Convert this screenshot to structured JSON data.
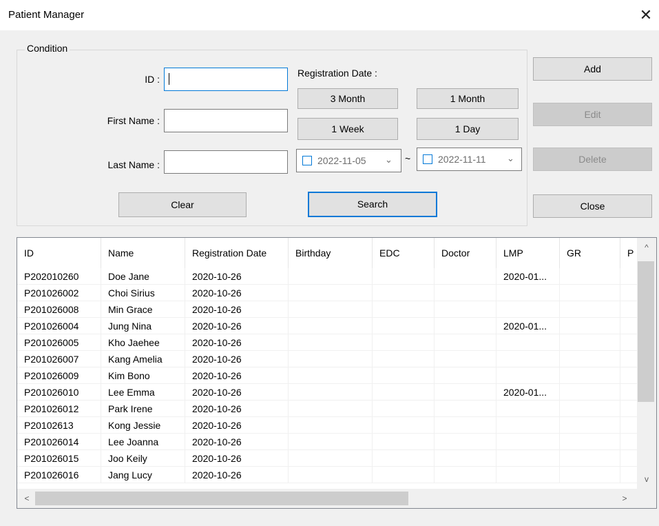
{
  "window": {
    "title": "Patient Manager",
    "close_glyph": "✕"
  },
  "condition": {
    "group_label": "Condition",
    "id_label": "ID :",
    "id_value": "",
    "first_name_label": "First Name :",
    "first_name_value": "",
    "last_name_label": "Last Name :",
    "last_name_value": "",
    "registration_date_label": "Registration Date :",
    "range_buttons": {
      "three_month": "3 Month",
      "one_month": "1 Month",
      "one_week": "1 Week",
      "one_day": "1 Day"
    },
    "date_from": "2022-11-05",
    "date_to": "2022-11-11",
    "tilde": "~",
    "clear_label": "Clear",
    "search_label": "Search"
  },
  "side_buttons": {
    "add": "Add",
    "edit": "Edit",
    "delete": "Delete",
    "close": "Close"
  },
  "table": {
    "columns": [
      "ID",
      "Name",
      "Registration Date",
      "Birthday",
      "EDC",
      "Doctor",
      "LMP",
      "GR",
      "P"
    ],
    "rows": [
      [
        "P202010260",
        "Doe Jane",
        "2020-10-26",
        "",
        "",
        "",
        "2020-01...",
        "",
        ""
      ],
      [
        "P201026002",
        "Choi Sirius",
        "2020-10-26",
        "",
        "",
        "",
        "",
        "",
        ""
      ],
      [
        "P201026008",
        "Min Grace",
        "2020-10-26",
        "",
        "",
        "",
        "",
        "",
        ""
      ],
      [
        "P201026004",
        "Jung Nina",
        "2020-10-26",
        "",
        "",
        "",
        "2020-01...",
        "",
        ""
      ],
      [
        "P201026005",
        "Kho Jaehee",
        "2020-10-26",
        "",
        "",
        "",
        "",
        "",
        ""
      ],
      [
        "P201026007",
        "Kang Amelia",
        "2020-10-26",
        "",
        "",
        "",
        "",
        "",
        ""
      ],
      [
        "P201026009",
        "Kim Bono",
        "2020-10-26",
        "",
        "",
        "",
        "",
        "",
        ""
      ],
      [
        "P201026010",
        "Lee Emma",
        "2020-10-26",
        "",
        "",
        "",
        "2020-01...",
        "",
        ""
      ],
      [
        "P201026012",
        "Park Irene",
        "2020-10-26",
        "",
        "",
        "",
        "",
        "",
        ""
      ],
      [
        "P20102613",
        "Kong Jessie",
        "2020-10-26",
        "",
        "",
        "",
        "",
        "",
        ""
      ],
      [
        "P201026014",
        "Lee Joanna",
        "2020-10-26",
        "",
        "",
        "",
        "",
        "",
        ""
      ],
      [
        "P201026015",
        "Joo Keily",
        "2020-10-26",
        "",
        "",
        "",
        "",
        "",
        ""
      ],
      [
        "P201026016",
        "Jang Lucy",
        "2020-10-26",
        "",
        "",
        "",
        "",
        "",
        ""
      ]
    ]
  },
  "scroll": {
    "up": "^",
    "down": "v",
    "left": "<",
    "right": ">"
  }
}
